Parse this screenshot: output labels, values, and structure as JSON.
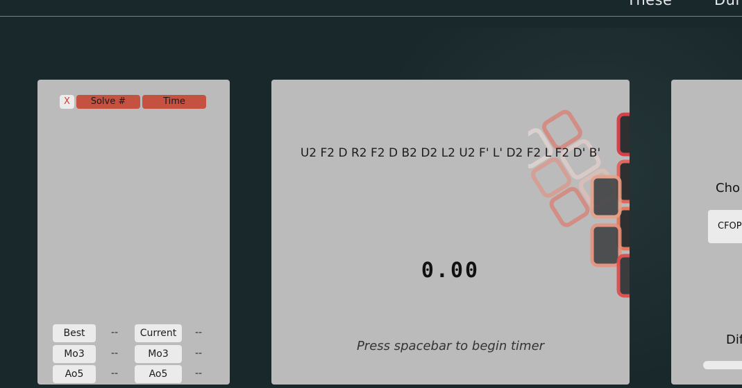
{
  "nav": {
    "links": [
      "These",
      "Dur"
    ]
  },
  "left_panel": {
    "header": {
      "clear_label": "X",
      "solve_label": "Solve #",
      "time_label": "Time"
    },
    "stats": {
      "best_label": "Best",
      "best_value": "--",
      "current_label": "Current",
      "current_value": "--",
      "rows": [
        {
          "left_label": "Mo3",
          "left_value": "--",
          "right_label": "Mo3",
          "right_value": "--"
        },
        {
          "left_label": "Ao5",
          "left_value": "--",
          "right_label": "Ao5",
          "right_value": "--"
        }
      ]
    }
  },
  "center_panel": {
    "scramble": "U2 F2 D R2 F2 D B2 D2 L2 U2 F' L' D2 F2 L F2 D' B'",
    "timer": "0.00",
    "hint": "Press spacebar to begin timer"
  },
  "right_panel": {
    "choose_label": "Cho",
    "method_value": "CFOP",
    "difficulty_label": "Dif"
  },
  "colors": {
    "accent": "#c55141",
    "panel": "#bcbbbb",
    "background": "#19282b",
    "nav_rule": "#c66a4f"
  }
}
